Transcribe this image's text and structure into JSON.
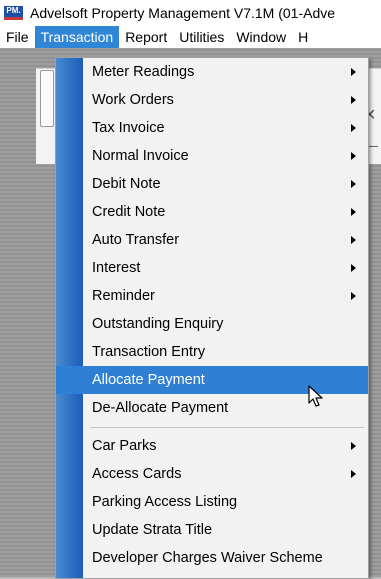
{
  "window": {
    "icon_text": "PM.",
    "title": "Advelsoft Property Management V7.1M (01-Adve"
  },
  "menubar": {
    "items": [
      "File",
      "Transaction",
      "Report",
      "Utilities",
      "Window",
      "H"
    ],
    "active_index": 1
  },
  "transaction_menu": {
    "items": [
      {
        "label": "Meter Readings",
        "has_submenu": true
      },
      {
        "label": "Work Orders",
        "has_submenu": true
      },
      {
        "label": "Tax Invoice",
        "has_submenu": true
      },
      {
        "label": "Normal Invoice",
        "has_submenu": true
      },
      {
        "label": "Debit Note",
        "has_submenu": true
      },
      {
        "label": "Credit Note",
        "has_submenu": true
      },
      {
        "label": "Auto Transfer",
        "has_submenu": true
      },
      {
        "label": "Interest",
        "has_submenu": true
      },
      {
        "label": "Reminder",
        "has_submenu": true
      },
      {
        "label": "Outstanding Enquiry",
        "has_submenu": false
      },
      {
        "label": "Transaction Entry",
        "has_submenu": false
      },
      {
        "label": "Allocate Payment",
        "has_submenu": false,
        "highlighted": true
      },
      {
        "label": "De-Allocate Payment",
        "has_submenu": false
      },
      {
        "separator": true
      },
      {
        "label": "Car Parks",
        "has_submenu": true
      },
      {
        "label": "Access Cards",
        "has_submenu": true
      },
      {
        "label": "Parking Access Listing",
        "has_submenu": false
      },
      {
        "label": "Update Strata Title",
        "has_submenu": false
      },
      {
        "label": "Developer Charges Waiver Scheme",
        "has_submenu": false
      }
    ]
  },
  "colors": {
    "highlight": "#2f80d4",
    "strip": "#2a6ec4",
    "menu_background": "#f2f2f2"
  }
}
